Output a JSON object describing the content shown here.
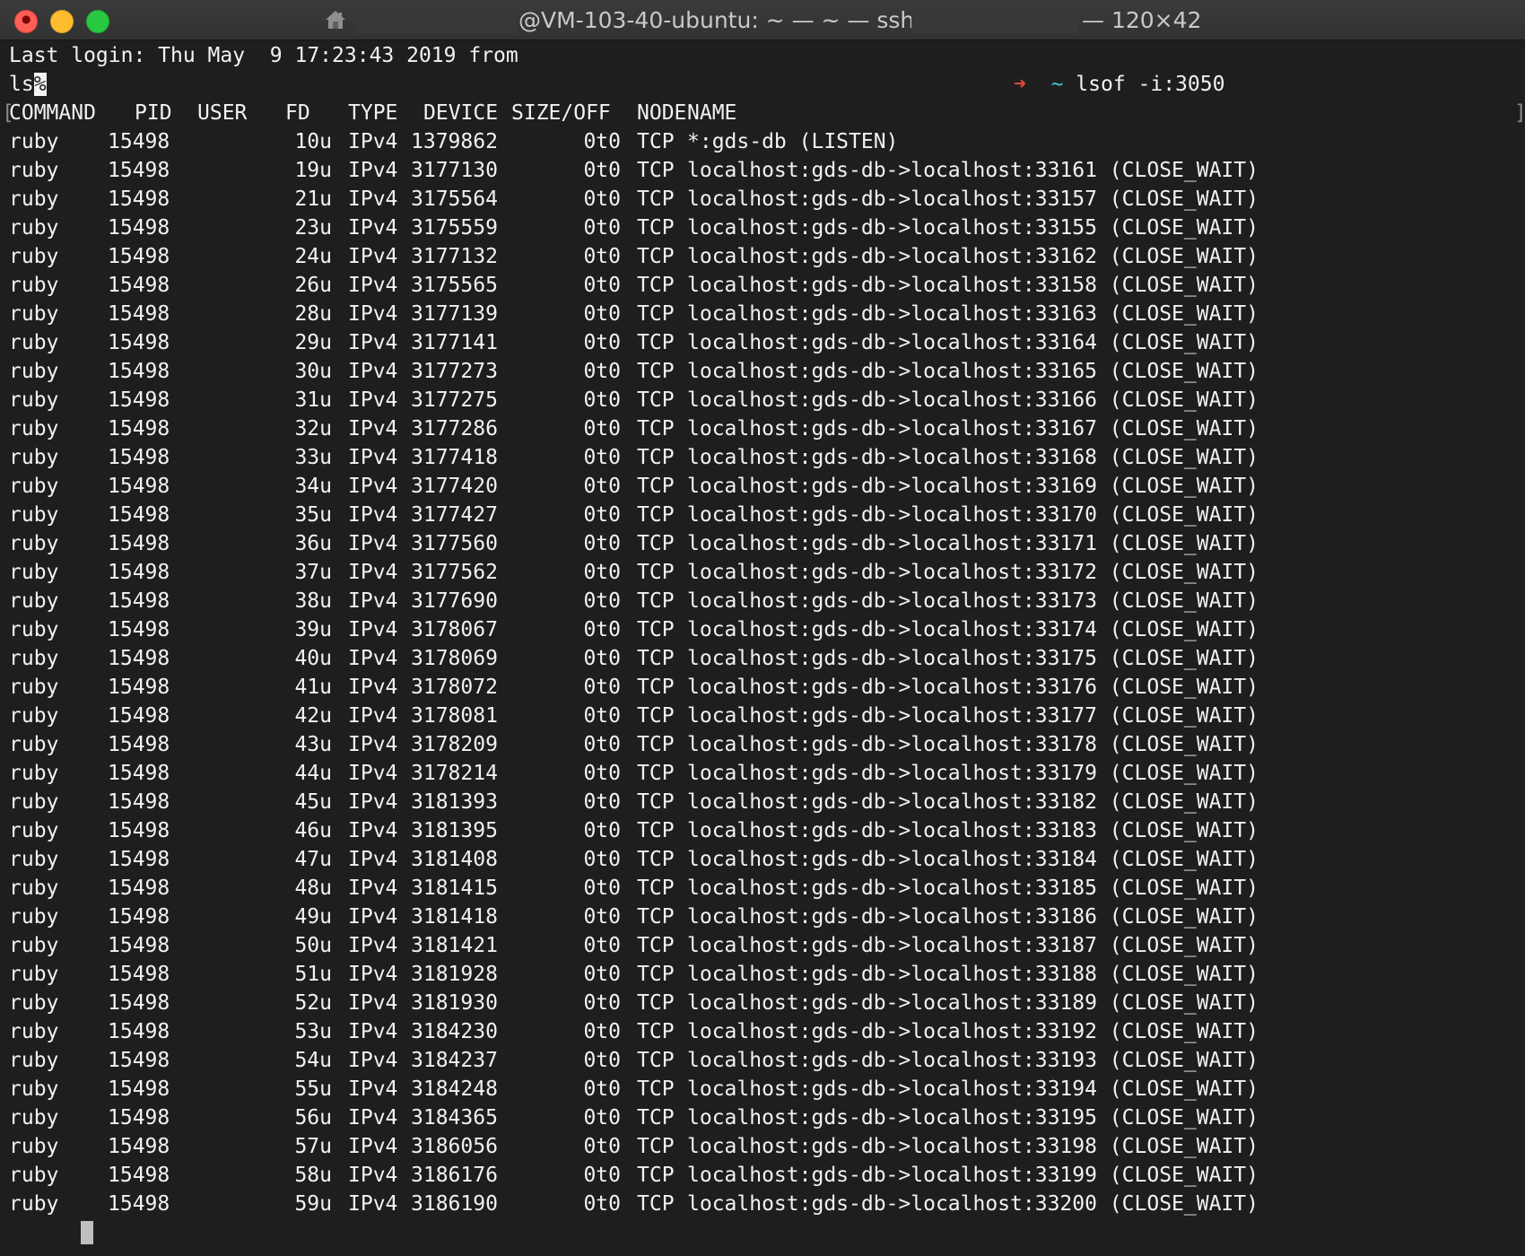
{
  "window": {
    "title_host": "@VM-103-40-ubuntu: ~ — ~ — ssh",
    "title_size": "— 120×42",
    "colors": {
      "background": "#1e1e1e",
      "text": "#f2f2f2",
      "arrow_red": "#e54a3b",
      "tilde": "#41c3d6",
      "arrow_green": "#2fc24b"
    }
  },
  "terminal": {
    "last_login": "Last login: Thu May  9 17:23:43 2019 from",
    "typed_prefix": "ls",
    "typed_cursor_char": "%",
    "prompt_arrow": "➜",
    "prompt_tilde": "~",
    "prompt_command": "lsof -i:3050",
    "headers": {
      "command": "COMMAND",
      "pid": "PID",
      "user": "USER",
      "fd": "FD",
      "type": "TYPE",
      "device": "DEVICE",
      "size": "SIZE/OFF",
      "node": "NODE",
      "name": "NAME"
    },
    "rows": [
      {
        "cmd": "ruby",
        "pid": "15498",
        "fd": "10u",
        "type": "IPv4",
        "device": "1379862",
        "size": "0t0",
        "node": "TCP",
        "name": "*:gds-db (LISTEN)"
      },
      {
        "cmd": "ruby",
        "pid": "15498",
        "fd": "19u",
        "type": "IPv4",
        "device": "3177130",
        "size": "0t0",
        "node": "TCP",
        "name": "localhost:gds-db->localhost:33161 (CLOSE_WAIT)"
      },
      {
        "cmd": "ruby",
        "pid": "15498",
        "fd": "21u",
        "type": "IPv4",
        "device": "3175564",
        "size": "0t0",
        "node": "TCP",
        "name": "localhost:gds-db->localhost:33157 (CLOSE_WAIT)"
      },
      {
        "cmd": "ruby",
        "pid": "15498",
        "fd": "23u",
        "type": "IPv4",
        "device": "3175559",
        "size": "0t0",
        "node": "TCP",
        "name": "localhost:gds-db->localhost:33155 (CLOSE_WAIT)"
      },
      {
        "cmd": "ruby",
        "pid": "15498",
        "fd": "24u",
        "type": "IPv4",
        "device": "3177132",
        "size": "0t0",
        "node": "TCP",
        "name": "localhost:gds-db->localhost:33162 (CLOSE_WAIT)"
      },
      {
        "cmd": "ruby",
        "pid": "15498",
        "fd": "26u",
        "type": "IPv4",
        "device": "3175565",
        "size": "0t0",
        "node": "TCP",
        "name": "localhost:gds-db->localhost:33158 (CLOSE_WAIT)"
      },
      {
        "cmd": "ruby",
        "pid": "15498",
        "fd": "28u",
        "type": "IPv4",
        "device": "3177139",
        "size": "0t0",
        "node": "TCP",
        "name": "localhost:gds-db->localhost:33163 (CLOSE_WAIT)"
      },
      {
        "cmd": "ruby",
        "pid": "15498",
        "fd": "29u",
        "type": "IPv4",
        "device": "3177141",
        "size": "0t0",
        "node": "TCP",
        "name": "localhost:gds-db->localhost:33164 (CLOSE_WAIT)"
      },
      {
        "cmd": "ruby",
        "pid": "15498",
        "fd": "30u",
        "type": "IPv4",
        "device": "3177273",
        "size": "0t0",
        "node": "TCP",
        "name": "localhost:gds-db->localhost:33165 (CLOSE_WAIT)"
      },
      {
        "cmd": "ruby",
        "pid": "15498",
        "fd": "31u",
        "type": "IPv4",
        "device": "3177275",
        "size": "0t0",
        "node": "TCP",
        "name": "localhost:gds-db->localhost:33166 (CLOSE_WAIT)"
      },
      {
        "cmd": "ruby",
        "pid": "15498",
        "fd": "32u",
        "type": "IPv4",
        "device": "3177286",
        "size": "0t0",
        "node": "TCP",
        "name": "localhost:gds-db->localhost:33167 (CLOSE_WAIT)"
      },
      {
        "cmd": "ruby",
        "pid": "15498",
        "fd": "33u",
        "type": "IPv4",
        "device": "3177418",
        "size": "0t0",
        "node": "TCP",
        "name": "localhost:gds-db->localhost:33168 (CLOSE_WAIT)"
      },
      {
        "cmd": "ruby",
        "pid": "15498",
        "fd": "34u",
        "type": "IPv4",
        "device": "3177420",
        "size": "0t0",
        "node": "TCP",
        "name": "localhost:gds-db->localhost:33169 (CLOSE_WAIT)"
      },
      {
        "cmd": "ruby",
        "pid": "15498",
        "fd": "35u",
        "type": "IPv4",
        "device": "3177427",
        "size": "0t0",
        "node": "TCP",
        "name": "localhost:gds-db->localhost:33170 (CLOSE_WAIT)"
      },
      {
        "cmd": "ruby",
        "pid": "15498",
        "fd": "36u",
        "type": "IPv4",
        "device": "3177560",
        "size": "0t0",
        "node": "TCP",
        "name": "localhost:gds-db->localhost:33171 (CLOSE_WAIT)"
      },
      {
        "cmd": "ruby",
        "pid": "15498",
        "fd": "37u",
        "type": "IPv4",
        "device": "3177562",
        "size": "0t0",
        "node": "TCP",
        "name": "localhost:gds-db->localhost:33172 (CLOSE_WAIT)"
      },
      {
        "cmd": "ruby",
        "pid": "15498",
        "fd": "38u",
        "type": "IPv4",
        "device": "3177690",
        "size": "0t0",
        "node": "TCP",
        "name": "localhost:gds-db->localhost:33173 (CLOSE_WAIT)"
      },
      {
        "cmd": "ruby",
        "pid": "15498",
        "fd": "39u",
        "type": "IPv4",
        "device": "3178067",
        "size": "0t0",
        "node": "TCP",
        "name": "localhost:gds-db->localhost:33174 (CLOSE_WAIT)"
      },
      {
        "cmd": "ruby",
        "pid": "15498",
        "fd": "40u",
        "type": "IPv4",
        "device": "3178069",
        "size": "0t0",
        "node": "TCP",
        "name": "localhost:gds-db->localhost:33175 (CLOSE_WAIT)"
      },
      {
        "cmd": "ruby",
        "pid": "15498",
        "fd": "41u",
        "type": "IPv4",
        "device": "3178072",
        "size": "0t0",
        "node": "TCP",
        "name": "localhost:gds-db->localhost:33176 (CLOSE_WAIT)"
      },
      {
        "cmd": "ruby",
        "pid": "15498",
        "fd": "42u",
        "type": "IPv4",
        "device": "3178081",
        "size": "0t0",
        "node": "TCP",
        "name": "localhost:gds-db->localhost:33177 (CLOSE_WAIT)"
      },
      {
        "cmd": "ruby",
        "pid": "15498",
        "fd": "43u",
        "type": "IPv4",
        "device": "3178209",
        "size": "0t0",
        "node": "TCP",
        "name": "localhost:gds-db->localhost:33178 (CLOSE_WAIT)"
      },
      {
        "cmd": "ruby",
        "pid": "15498",
        "fd": "44u",
        "type": "IPv4",
        "device": "3178214",
        "size": "0t0",
        "node": "TCP",
        "name": "localhost:gds-db->localhost:33179 (CLOSE_WAIT)"
      },
      {
        "cmd": "ruby",
        "pid": "15498",
        "fd": "45u",
        "type": "IPv4",
        "device": "3181393",
        "size": "0t0",
        "node": "TCP",
        "name": "localhost:gds-db->localhost:33182 (CLOSE_WAIT)"
      },
      {
        "cmd": "ruby",
        "pid": "15498",
        "fd": "46u",
        "type": "IPv4",
        "device": "3181395",
        "size": "0t0",
        "node": "TCP",
        "name": "localhost:gds-db->localhost:33183 (CLOSE_WAIT)"
      },
      {
        "cmd": "ruby",
        "pid": "15498",
        "fd": "47u",
        "type": "IPv4",
        "device": "3181408",
        "size": "0t0",
        "node": "TCP",
        "name": "localhost:gds-db->localhost:33184 (CLOSE_WAIT)"
      },
      {
        "cmd": "ruby",
        "pid": "15498",
        "fd": "48u",
        "type": "IPv4",
        "device": "3181415",
        "size": "0t0",
        "node": "TCP",
        "name": "localhost:gds-db->localhost:33185 (CLOSE_WAIT)"
      },
      {
        "cmd": "ruby",
        "pid": "15498",
        "fd": "49u",
        "type": "IPv4",
        "device": "3181418",
        "size": "0t0",
        "node": "TCP",
        "name": "localhost:gds-db->localhost:33186 (CLOSE_WAIT)"
      },
      {
        "cmd": "ruby",
        "pid": "15498",
        "fd": "50u",
        "type": "IPv4",
        "device": "3181421",
        "size": "0t0",
        "node": "TCP",
        "name": "localhost:gds-db->localhost:33187 (CLOSE_WAIT)"
      },
      {
        "cmd": "ruby",
        "pid": "15498",
        "fd": "51u",
        "type": "IPv4",
        "device": "3181928",
        "size": "0t0",
        "node": "TCP",
        "name": "localhost:gds-db->localhost:33188 (CLOSE_WAIT)"
      },
      {
        "cmd": "ruby",
        "pid": "15498",
        "fd": "52u",
        "type": "IPv4",
        "device": "3181930",
        "size": "0t0",
        "node": "TCP",
        "name": "localhost:gds-db->localhost:33189 (CLOSE_WAIT)"
      },
      {
        "cmd": "ruby",
        "pid": "15498",
        "fd": "53u",
        "type": "IPv4",
        "device": "3184230",
        "size": "0t0",
        "node": "TCP",
        "name": "localhost:gds-db->localhost:33192 (CLOSE_WAIT)"
      },
      {
        "cmd": "ruby",
        "pid": "15498",
        "fd": "54u",
        "type": "IPv4",
        "device": "3184237",
        "size": "0t0",
        "node": "TCP",
        "name": "localhost:gds-db->localhost:33193 (CLOSE_WAIT)"
      },
      {
        "cmd": "ruby",
        "pid": "15498",
        "fd": "55u",
        "type": "IPv4",
        "device": "3184248",
        "size": "0t0",
        "node": "TCP",
        "name": "localhost:gds-db->localhost:33194 (CLOSE_WAIT)"
      },
      {
        "cmd": "ruby",
        "pid": "15498",
        "fd": "56u",
        "type": "IPv4",
        "device": "3184365",
        "size": "0t0",
        "node": "TCP",
        "name": "localhost:gds-db->localhost:33195 (CLOSE_WAIT)"
      },
      {
        "cmd": "ruby",
        "pid": "15498",
        "fd": "57u",
        "type": "IPv4",
        "device": "3186056",
        "size": "0t0",
        "node": "TCP",
        "name": "localhost:gds-db->localhost:33198 (CLOSE_WAIT)"
      },
      {
        "cmd": "ruby",
        "pid": "15498",
        "fd": "58u",
        "type": "IPv4",
        "device": "3186176",
        "size": "0t0",
        "node": "TCP",
        "name": "localhost:gds-db->localhost:33199 (CLOSE_WAIT)"
      },
      {
        "cmd": "ruby",
        "pid": "15498",
        "fd": "59u",
        "type": "IPv4",
        "device": "3186190",
        "size": "0t0",
        "node": "TCP",
        "name": "localhost:gds-db->localhost:33200 (CLOSE_WAIT)"
      }
    ],
    "final_prompt_arrow": "➜",
    "final_prompt_tilde": "~"
  }
}
